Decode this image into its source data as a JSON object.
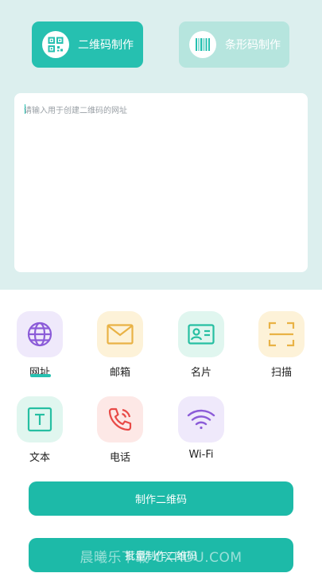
{
  "header": {
    "tabs": [
      {
        "label": "二维码制作",
        "icon": "qr-code-icon",
        "active": true
      },
      {
        "label": "条形码制作",
        "icon": "barcode-icon",
        "active": false
      }
    ]
  },
  "input": {
    "placeholder": "请输入用于创建二维码的网址",
    "value": ""
  },
  "types": [
    {
      "label": "网址",
      "icon": "globe-icon",
      "selected": true
    },
    {
      "label": "邮箱",
      "icon": "mail-icon",
      "selected": false
    },
    {
      "label": "名片",
      "icon": "business-card-icon",
      "selected": false
    },
    {
      "label": "扫描",
      "icon": "scan-icon",
      "selected": false
    },
    {
      "label": "文本",
      "icon": "text-icon",
      "selected": false
    },
    {
      "label": "电话",
      "icon": "phone-icon",
      "selected": false
    },
    {
      "label": "Wi-Fi",
      "icon": "wifi-icon",
      "selected": false
    }
  ],
  "actions": {
    "make_label": "制作二维码",
    "batch_label": "批量制作二维码"
  },
  "watermark": "晨曦乐下载 CXRDU.COM",
  "colors": {
    "accent": "#26c0b0",
    "header_bg": "#dcefee",
    "inactive_tab": "#b6e5de"
  }
}
